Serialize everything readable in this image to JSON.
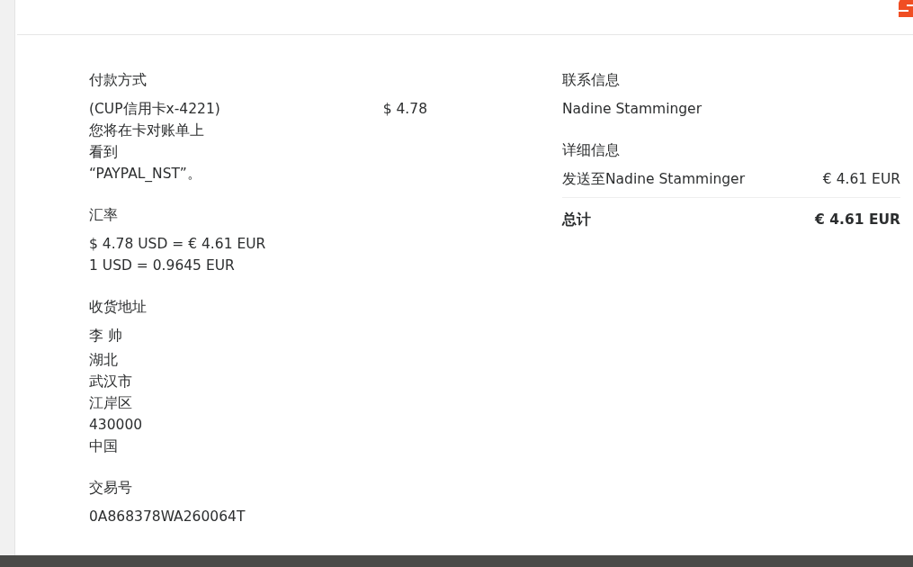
{
  "payment": {
    "title": "付款方式",
    "lines": [
      "(CUP信用卡x-4221)",
      "您将在卡对账单上",
      "看到",
      "“PAYPAL_NST”。"
    ],
    "amount": "$ 4.78"
  },
  "exchange": {
    "title": "汇率",
    "lines": [
      "$ 4.78 USD = € 4.61 EUR",
      "1 USD = 0.9645 EUR"
    ]
  },
  "shipping": {
    "title": "收货地址",
    "lines": [
      "李 帅",
      "湖北",
      "武汉市",
      "江岸区",
      "430000",
      "中国"
    ]
  },
  "transaction": {
    "title": "交易号",
    "value": "0A868378WA260064T"
  },
  "contact": {
    "title": "联系信息",
    "name": "Nadine Stamminger"
  },
  "details": {
    "title": "详细信息",
    "rows": [
      {
        "label": "发送至Nadine Stamminger",
        "amount": "€ 4.61 EUR"
      }
    ],
    "total": {
      "label": "总计",
      "amount": "€ 4.61 EUR"
    }
  }
}
